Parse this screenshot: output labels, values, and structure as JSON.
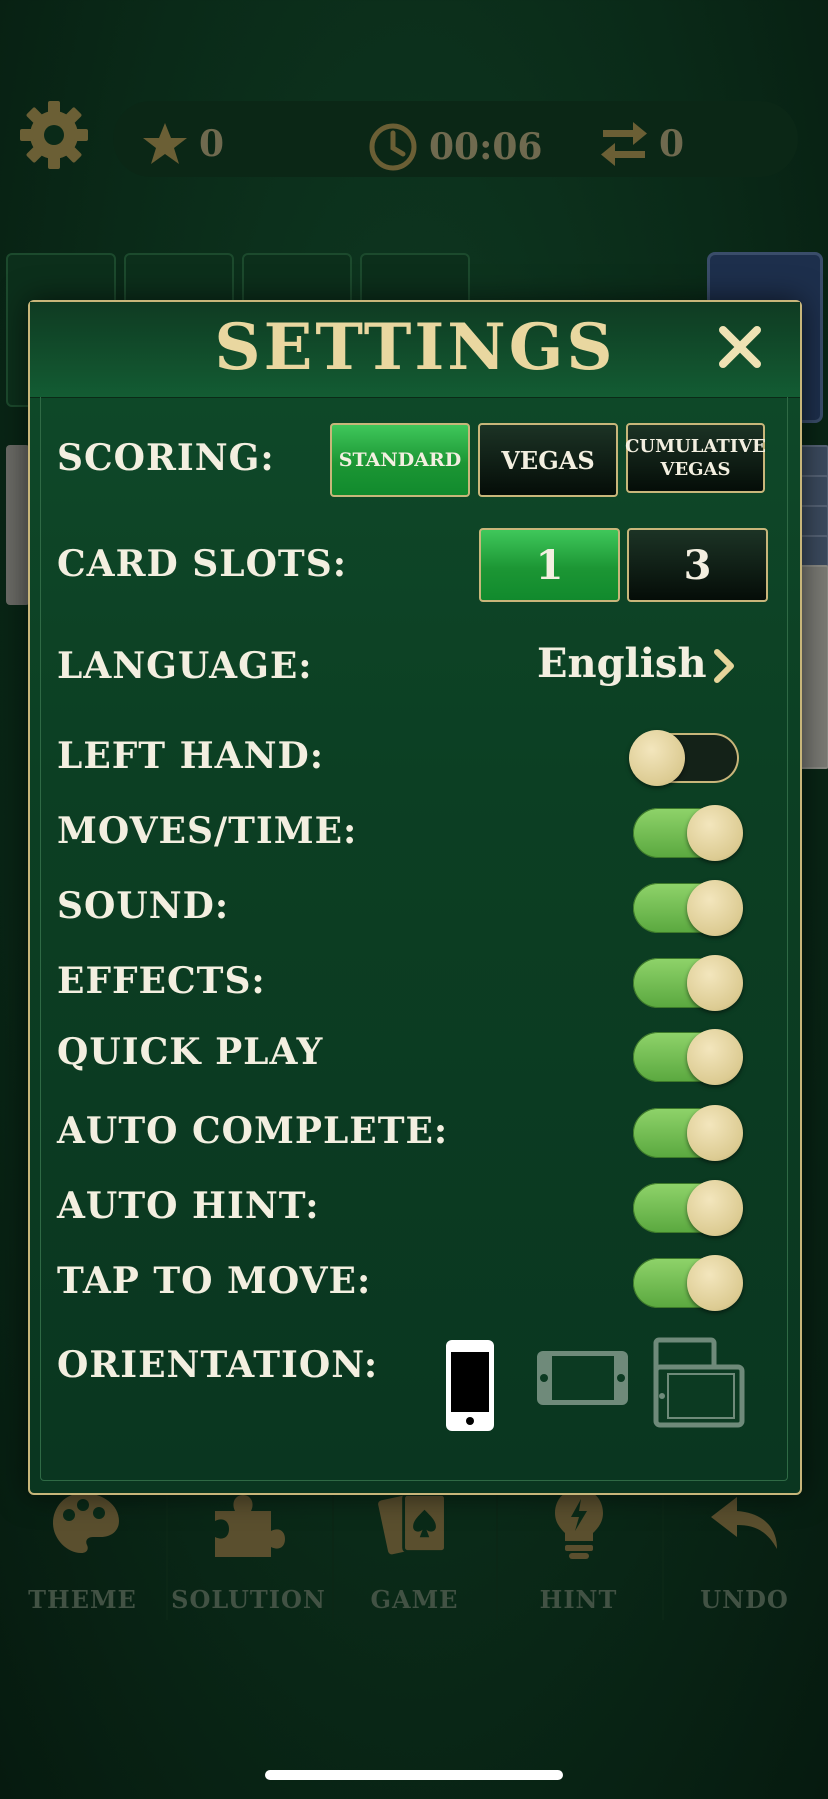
{
  "hud": {
    "stars": "0",
    "time": "00:06",
    "moves": "0"
  },
  "nav": {
    "items": [
      {
        "label": "THEME"
      },
      {
        "label": "SOLUTION"
      },
      {
        "label": "GAME"
      },
      {
        "label": "HINT"
      },
      {
        "label": "UNDO"
      }
    ]
  },
  "settings": {
    "title": "SETTINGS",
    "scoring": {
      "label": "SCORING:",
      "options": [
        "STANDARD",
        "VEGAS",
        "CUMULATIVE VEGAS"
      ],
      "selected": "STANDARD"
    },
    "card_slots": {
      "label": "CARD SLOTS:",
      "options": [
        "1",
        "3"
      ],
      "selected": "1"
    },
    "language": {
      "label": "LANGUAGE:",
      "value": "English"
    },
    "toggles": [
      {
        "label": "LEFT HAND:",
        "on": false
      },
      {
        "label": "MOVES/TIME:",
        "on": true
      },
      {
        "label": "SOUND:",
        "on": true
      },
      {
        "label": "EFFECTS:",
        "on": true
      },
      {
        "label": "QUICK PLAY",
        "on": true
      },
      {
        "label": "AUTO COMPLETE:",
        "on": true
      },
      {
        "label": "AUTO HINT:",
        "on": true
      },
      {
        "label": "TAP TO MOVE:",
        "on": true
      }
    ],
    "orientation": {
      "label": "ORIENTATION:",
      "options": [
        "portrait",
        "landscape",
        "auto"
      ],
      "selected": "portrait"
    }
  },
  "colors": {
    "accent_gold": "#c8b67a",
    "active_green": "#1c9634",
    "toggle_on": "#6cbb4c"
  }
}
